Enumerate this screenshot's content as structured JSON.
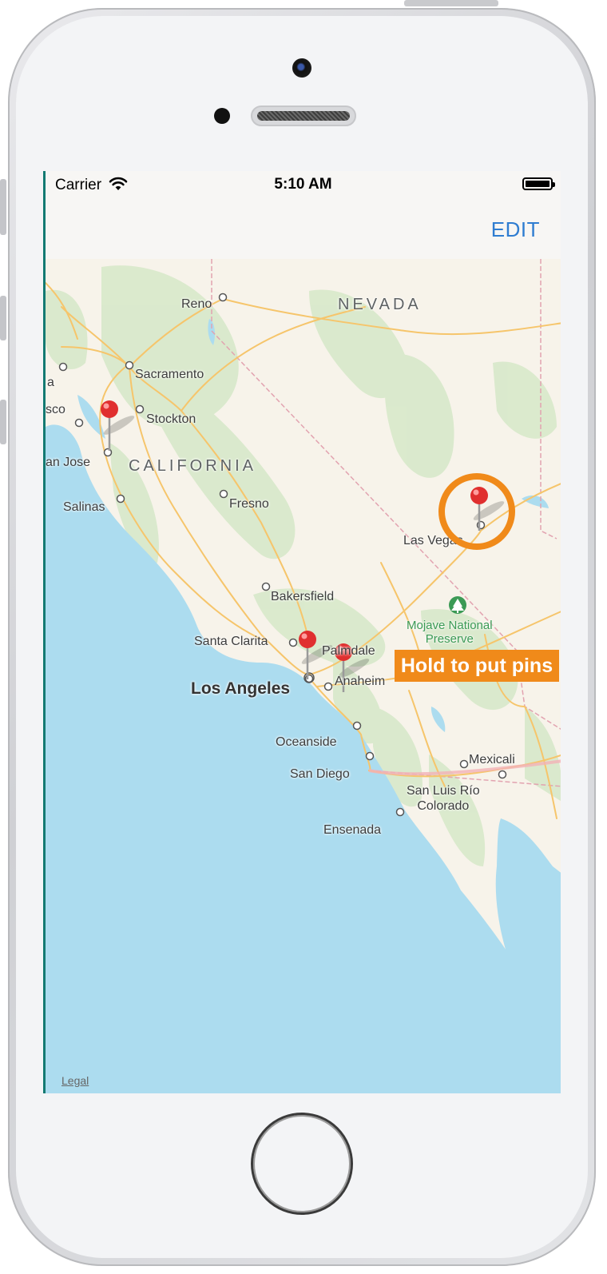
{
  "status_bar": {
    "carrier": "Carrier",
    "time": "5:10 AM"
  },
  "nav": {
    "edit_label": "EDIT"
  },
  "map": {
    "states": [
      "NEVADA",
      "CALIFORNIA"
    ],
    "cities": {
      "reno": "Reno",
      "sacramento": "Sacramento",
      "stockton": "Stockton",
      "sf_partial": "sco",
      "a_partial": "a",
      "san_jose": "an Jose",
      "salinas": "Salinas",
      "fresno": "Fresno",
      "bakersfield": "Bakersfield",
      "santa_clarita": "Santa Clarita",
      "palmdale": "Palmdale",
      "los_angeles": "Los Angeles",
      "anaheim": "Anaheim",
      "oceanside": "Oceanside",
      "san_diego": "San Diego",
      "ensenada": "Ensenada",
      "mexicali": "Mexicali",
      "san_luis": "San Luis Río\nColorado",
      "las_vegas": "Las Vegas",
      "mojave": "Mojave National\nPreserve"
    },
    "legal": "Legal",
    "hint": "Hold to put pins",
    "pin_count": 4,
    "colors": {
      "land": "#f7f3ea",
      "water": "#acdcef",
      "park": "#cfe3c0",
      "road": "#f6c56b",
      "pin": "#e02f2f",
      "accent": "#f08a1a"
    }
  }
}
